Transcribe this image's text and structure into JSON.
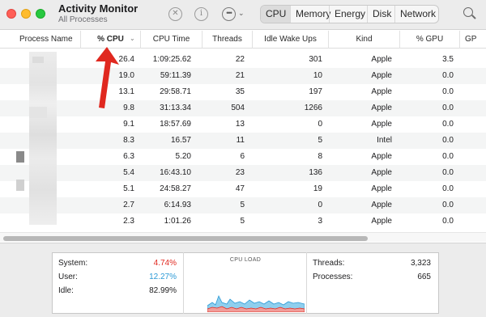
{
  "app": {
    "title": "Activity Monitor",
    "subtitle": "All Processes"
  },
  "toolbar": {
    "icons": [
      "stop-icon",
      "info-icon",
      "more-icon",
      "chevron-down-icon",
      "search-icon"
    ],
    "tabs": [
      "CPU",
      "Memory",
      "Energy",
      "Disk",
      "Network"
    ],
    "active_tab": "CPU"
  },
  "columns": {
    "process_name": "Process Name",
    "cpu": "% CPU",
    "cpu_time": "CPU Time",
    "threads": "Threads",
    "idle_wake_ups": "Idle Wake Ups",
    "kind": "Kind",
    "gpu": "% GPU",
    "gpu_time": "GP"
  },
  "sort_column": "% CPU",
  "rows": [
    {
      "cpu": "26.4",
      "cpu_time": "1:09:25.62",
      "threads": "22",
      "idle_wake_ups": "301",
      "kind": "Apple",
      "gpu": "3.5"
    },
    {
      "cpu": "19.0",
      "cpu_time": "59:11.39",
      "threads": "21",
      "idle_wake_ups": "10",
      "kind": "Apple",
      "gpu": "0.0"
    },
    {
      "cpu": "13.1",
      "cpu_time": "29:58.71",
      "threads": "35",
      "idle_wake_ups": "197",
      "kind": "Apple",
      "gpu": "0.0"
    },
    {
      "cpu": "9.8",
      "cpu_time": "31:13.34",
      "threads": "504",
      "idle_wake_ups": "1266",
      "kind": "Apple",
      "gpu": "0.0"
    },
    {
      "cpu": "9.1",
      "cpu_time": "18:57.69",
      "threads": "13",
      "idle_wake_ups": "0",
      "kind": "Apple",
      "gpu": "0.0"
    },
    {
      "cpu": "8.3",
      "cpu_time": "16.57",
      "threads": "11",
      "idle_wake_ups": "5",
      "kind": "Intel",
      "gpu": "0.0"
    },
    {
      "cpu": "6.3",
      "cpu_time": "5.20",
      "threads": "6",
      "idle_wake_ups": "8",
      "kind": "Apple",
      "gpu": "0.0"
    },
    {
      "cpu": "5.4",
      "cpu_time": "16:43.10",
      "threads": "23",
      "idle_wake_ups": "136",
      "kind": "Apple",
      "gpu": "0.0"
    },
    {
      "cpu": "5.1",
      "cpu_time": "24:58.27",
      "threads": "47",
      "idle_wake_ups": "19",
      "kind": "Apple",
      "gpu": "0.0"
    },
    {
      "cpu": "2.7",
      "cpu_time": "6:14.93",
      "threads": "5",
      "idle_wake_ups": "0",
      "kind": "Apple",
      "gpu": "0.0"
    },
    {
      "cpu": "2.3",
      "cpu_time": "1:01.26",
      "threads": "5",
      "idle_wake_ups": "3",
      "kind": "Apple",
      "gpu": "0.0"
    }
  ],
  "stats": {
    "system_label": "System:",
    "system_value": "4.74%",
    "user_label": "User:",
    "user_value": "12.27%",
    "idle_label": "Idle:",
    "idle_value": "82.99%",
    "load_title": "CPU LOAD",
    "threads_label": "Threads:",
    "threads_value": "3,323",
    "processes_label": "Processes:",
    "processes_value": "665"
  },
  "colors": {
    "system": "#e0281f",
    "user": "#2c9ad6",
    "arrow": "#e0281f"
  }
}
